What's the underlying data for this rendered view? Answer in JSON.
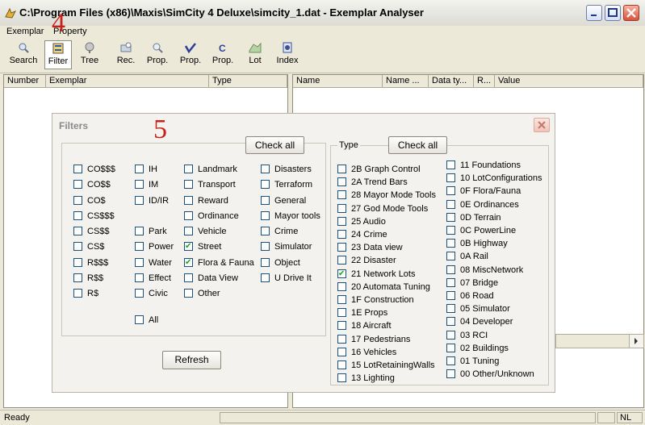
{
  "window": {
    "title": "C:\\Program Files (x86)\\Maxis\\SimCity 4 Deluxe\\simcity_1.dat - Exemplar Analyser"
  },
  "menu": [
    "Exemplar",
    "Property"
  ],
  "toolbar": [
    {
      "label": "Search",
      "icon": "search-icon"
    },
    {
      "label": "Filter",
      "icon": "filter-icon"
    },
    {
      "label": "Tree",
      "icon": "tree-icon"
    },
    {
      "label": "Rec.",
      "icon": "record-icon"
    },
    {
      "label": "Prop.",
      "icon": "search-property-icon"
    },
    {
      "label": "Prop.",
      "icon": "check-property-icon"
    },
    {
      "label": "Prop.",
      "icon": "copy-property-icon"
    },
    {
      "label": "Lot",
      "icon": "lot-icon"
    },
    {
      "label": "Index",
      "icon": "index-icon"
    }
  ],
  "annotations": {
    "mark_toolbar": "4",
    "mark_dialog": "5"
  },
  "left_columns": [
    "Number",
    "Exemplar",
    "Type"
  ],
  "right_columns": [
    "Name",
    "Name ...",
    "Data ty...",
    "R...",
    "Value"
  ],
  "status": {
    "text": "Ready",
    "right": "NL"
  },
  "dialog": {
    "title": "Filters",
    "check_all": "Check all",
    "refresh": "Refresh",
    "type_group": "Type",
    "col1": [
      {
        "label": "CO$$$",
        "checked": false
      },
      {
        "label": "CO$$",
        "checked": false
      },
      {
        "label": "CO$",
        "checked": false
      },
      {
        "label": "CS$$$",
        "checked": false
      },
      {
        "label": "CS$$",
        "checked": false
      },
      {
        "label": "CS$",
        "checked": false
      },
      {
        "label": "R$$$",
        "checked": false
      },
      {
        "label": "R$$",
        "checked": false
      },
      {
        "label": "R$",
        "checked": false
      }
    ],
    "col2": [
      {
        "label": "IH",
        "checked": false
      },
      {
        "label": "IM",
        "checked": false
      },
      {
        "label": "ID/IR",
        "checked": false
      },
      {
        "label": "Park",
        "checked": false
      },
      {
        "label": "Power",
        "checked": false
      },
      {
        "label": "Water",
        "checked": false
      },
      {
        "label": "Effect",
        "checked": false
      },
      {
        "label": "Civic",
        "checked": false
      }
    ],
    "col3": [
      {
        "label": "Landmark",
        "checked": false
      },
      {
        "label": "Transport",
        "checked": false
      },
      {
        "label": "Reward",
        "checked": false
      },
      {
        "label": "Ordinance",
        "checked": false
      },
      {
        "label": "Vehicle",
        "checked": false
      },
      {
        "label": "Street",
        "checked": true
      },
      {
        "label": "Flora & Fauna",
        "checked": true
      },
      {
        "label": "Data View",
        "checked": false
      },
      {
        "label": "Other",
        "checked": false
      }
    ],
    "col4": [
      {
        "label": "Disasters",
        "checked": false
      },
      {
        "label": "Terraform",
        "checked": false
      },
      {
        "label": "General",
        "checked": false
      },
      {
        "label": "Mayor tools",
        "checked": false
      },
      {
        "label": "Crime",
        "checked": false
      },
      {
        "label": "Simulator",
        "checked": false
      },
      {
        "label": "Object",
        "checked": false
      },
      {
        "label": "U Drive It",
        "checked": false
      }
    ],
    "all": {
      "label": "All",
      "checked": false
    },
    "types_left": [
      {
        "label": "2B Graph Control",
        "checked": false
      },
      {
        "label": "2A Trend Bars",
        "checked": false
      },
      {
        "label": "28 Mayor Mode Tools",
        "checked": false
      },
      {
        "label": "27 God Mode Tools",
        "checked": false
      },
      {
        "label": "25 Audio",
        "checked": false
      },
      {
        "label": "24 Crime",
        "checked": false
      },
      {
        "label": "23 Data view",
        "checked": false
      },
      {
        "label": "22 Disaster",
        "checked": false
      },
      {
        "label": "21 Network Lots",
        "checked": true
      },
      {
        "label": "20 Automata Tuning",
        "checked": false
      },
      {
        "label": "1F Construction",
        "checked": false
      },
      {
        "label": "1E Props",
        "checked": false
      },
      {
        "label": "18 Aircraft",
        "checked": false
      },
      {
        "label": "17 Pedestrians",
        "checked": false
      },
      {
        "label": "16 Vehicles",
        "checked": false
      },
      {
        "label": "15 LotRetainingWalls",
        "checked": false
      },
      {
        "label": "13 Lighting",
        "checked": false
      }
    ],
    "types_right": [
      {
        "label": "11 Foundations",
        "checked": false
      },
      {
        "label": "10 LotConfigurations",
        "checked": false
      },
      {
        "label": "0F Flora/Fauna",
        "checked": false
      },
      {
        "label": "0E Ordinances",
        "checked": false
      },
      {
        "label": "0D Terrain",
        "checked": false
      },
      {
        "label": "0C PowerLine",
        "checked": false
      },
      {
        "label": "0B Highway",
        "checked": false
      },
      {
        "label": "0A Rail",
        "checked": false
      },
      {
        "label": "08 MiscNetwork",
        "checked": false
      },
      {
        "label": "07 Bridge",
        "checked": false
      },
      {
        "label": "06 Road",
        "checked": false
      },
      {
        "label": "05 Simulator",
        "checked": false
      },
      {
        "label": "04 Developer",
        "checked": false
      },
      {
        "label": "03 RCI",
        "checked": false
      },
      {
        "label": "02 Buildings",
        "checked": false
      },
      {
        "label": "01 Tuning",
        "checked": false
      },
      {
        "label": "00 Other/Unknown",
        "checked": false
      }
    ]
  }
}
